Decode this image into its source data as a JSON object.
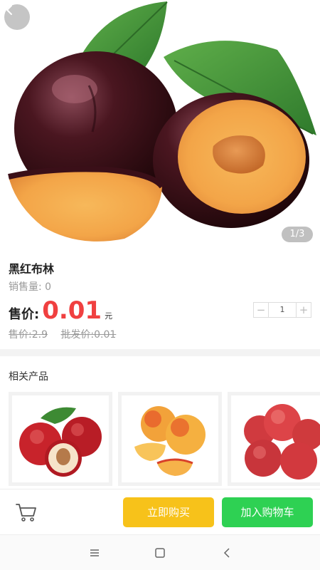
{
  "hero": {
    "image_counter": "1/3",
    "icons": {
      "back": "chevron-left-icon"
    }
  },
  "product": {
    "title": "黑红布林",
    "sales_label": "销售量",
    "sales_value": "0",
    "price_label": "售价:",
    "price_value": "0.01",
    "price_unit": "元",
    "original_price": "售价:2.9",
    "wholesale_price": "批发价:0.01",
    "quantity": "1",
    "quantity_minus": "−",
    "quantity_plus": "+"
  },
  "related": {
    "title": "相关产品",
    "items": [
      {
        "image": "nectarine-image"
      },
      {
        "image": "peach-image"
      },
      {
        "image": "red-peach-image"
      }
    ]
  },
  "actions": {
    "buy_now": "立即购买",
    "add_to_cart": "加入购物车",
    "icons": {
      "cart": "shopping-cart-icon"
    }
  },
  "colors": {
    "price": "#f04040",
    "buy_button": "#f7c21a",
    "cart_button": "#2ed153"
  },
  "system_nav": {
    "icons": [
      "menu-icon",
      "home-icon",
      "back-icon"
    ]
  }
}
